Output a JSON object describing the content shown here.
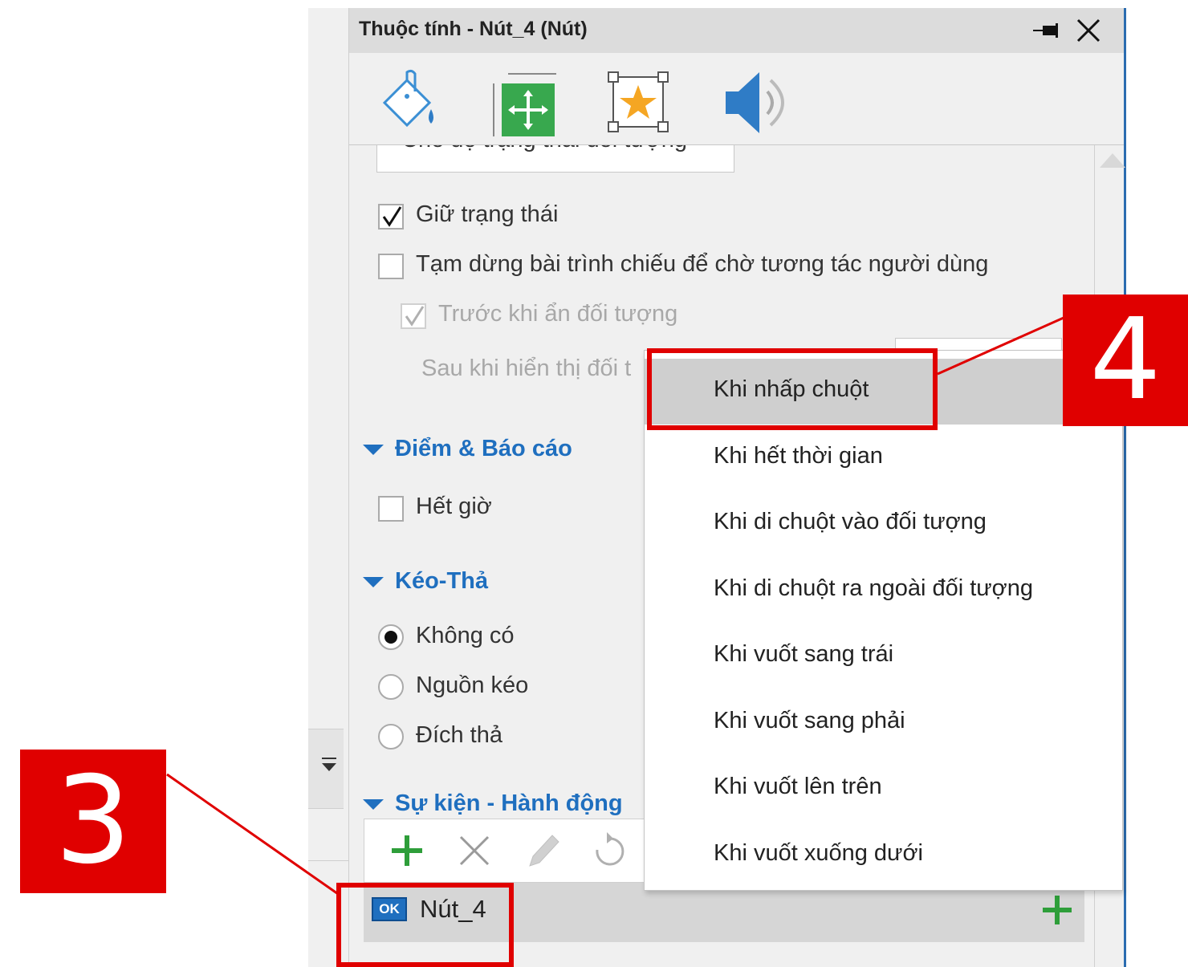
{
  "panel": {
    "title": "Thuộc tính - Nút_4 (Nút)",
    "tabs": [
      "fill-bucket-icon",
      "size-position-icon",
      "star-effects-icon",
      "audio-speaker-icon"
    ]
  },
  "state_mode_label": "Chế độ trạng thái đối tượng",
  "options": {
    "keep_state": "Giữ trạng thái",
    "pause_slide": "Tạm dừng bài trình chiếu để chờ tương tác người dùng",
    "before_hide": "Trước khi ẩn đối tượng",
    "after_show": "Sau khi hiển thị đối t"
  },
  "sections": {
    "score": "Điểm & Báo cáo",
    "timeout": "Hết giờ",
    "drag": "Kéo-Thả",
    "drag_none": "Không có",
    "drag_source": "Nguồn kéo",
    "drag_target": "Đích thả",
    "events": "Sự kiện - Hành động"
  },
  "events": {
    "item_badge": "OK",
    "item_name": "Nút_4"
  },
  "menu": {
    "items": [
      "Khi nhấp chuột",
      "Khi hết thời gian",
      "Khi di chuột vào đối tượng",
      "Khi di chuột ra ngoài đối tượng",
      "Khi vuốt sang trái",
      "Khi vuốt sang phải",
      "Khi vuốt lên trên",
      "Khi vuốt xuống dưới"
    ],
    "selected_index": 0
  },
  "annotations": {
    "badge_3": "3",
    "badge_4": "4"
  },
  "colors": {
    "accent": "#1f6fbf",
    "callout": "#e00000",
    "add_green": "#2e9e3a"
  }
}
